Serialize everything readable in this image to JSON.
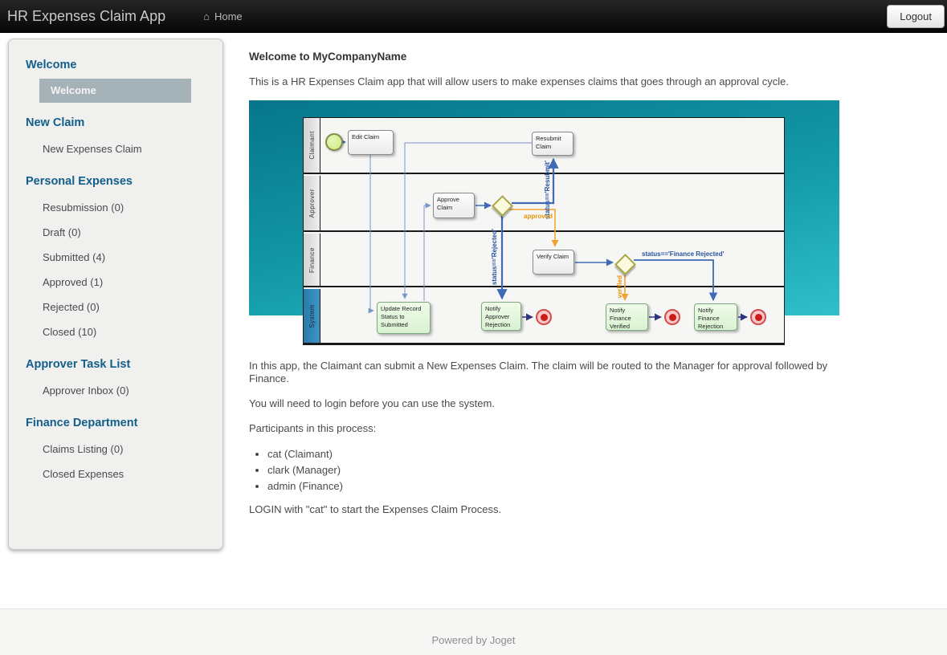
{
  "navbar": {
    "title": "HR Expenses Claim App",
    "home_label": "Home",
    "logout_label": "Logout"
  },
  "sidebar": {
    "sections": [
      {
        "heading": "Welcome",
        "items": [
          {
            "label": "Welcome",
            "active": true
          }
        ]
      },
      {
        "heading": "New Claim",
        "items": [
          {
            "label": "New Expenses Claim"
          }
        ]
      },
      {
        "heading": "Personal Expenses",
        "items": [
          {
            "label": "Resubmission (0)"
          },
          {
            "label": "Draft (0)"
          },
          {
            "label": "Submitted (4)"
          },
          {
            "label": "Approved (1)"
          },
          {
            "label": "Rejected (0)"
          },
          {
            "label": "Closed (10)"
          }
        ]
      },
      {
        "heading": "Approver Task List",
        "items": [
          {
            "label": "Approver Inbox (0)"
          }
        ]
      },
      {
        "heading": "Finance Department",
        "items": [
          {
            "label": "Claims Listing (0)"
          },
          {
            "label": "Closed Expenses"
          }
        ]
      }
    ]
  },
  "main": {
    "title": "Welcome to MyCompanyName",
    "intro": "This is a HR Expenses Claim app that will allow users to make expenses claims that goes through an approval cycle.",
    "para1": "In this app, the Claimant can submit a New Expenses Claim. The claim will be routed to the Manager for approval followed by Finance.",
    "para2": "You will need to login before you can use the system.",
    "para3": "Participants in this process:",
    "participants": [
      "cat (Claimant)",
      "clark (Manager)",
      "admin (Finance)"
    ],
    "para4": "LOGIN with \"cat\" to start the Expenses Claim Process."
  },
  "diagram": {
    "lanes": [
      "Claimant",
      "Approver",
      "Finance",
      "System"
    ],
    "nodes": {
      "edit_claim": "Edit Claim",
      "resubmit_claim": "Resubmit Claim",
      "approve_claim": "Approve Claim",
      "verify_claim": "Verify Claim",
      "update_record": "Update Record Status to Submitted",
      "notify_approver_rejection": "Notify Approver Rejection",
      "notify_finance_verified": "Notify Finance Verified",
      "notify_finance_rejection": "Notify Finance Rejection"
    },
    "edge_labels": {
      "resubmit": "status=='Resubmit'",
      "rejected": "status=='Rejected'",
      "approved": "approved",
      "verified": "verified",
      "finance_rejected": "status=='Finance Rejected'"
    }
  },
  "footer": {
    "text": "Powered by Joget"
  },
  "colors": {
    "navbar_bg": "#161616",
    "sidebar_heading": "#135e8a",
    "active_item_bg": "#a5b2b8",
    "banner_teal_dark": "#06768a",
    "banner_teal_light": "#2fbfcb",
    "system_lane_blue": "#3186b8",
    "connector_blue": "#3f6ab5",
    "connector_orange": "#f0a232",
    "task_green": "#ddf2d4",
    "end_event_red": "#ce1c1c"
  }
}
